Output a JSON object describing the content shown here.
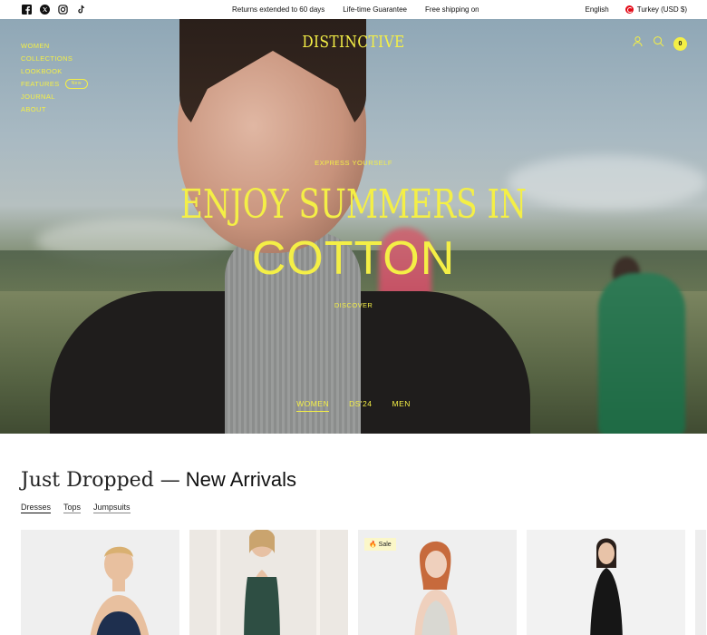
{
  "topbar": {
    "socials": [
      "facebook-icon",
      "x-icon",
      "instagram-icon",
      "tiktok-icon"
    ],
    "announcements": [
      "Returns extended to 60 days",
      "Life-time Guarantee",
      "Free shipping on"
    ],
    "language": "English",
    "currency": "Turkey (USD $)"
  },
  "header": {
    "logo": "DISTINCTIVE",
    "nav": [
      "WOMEN",
      "COLLECTIONS",
      "LOOKBOOK",
      "FEATURES",
      "JOURNAL",
      "ABOUT"
    ],
    "features_badge": "New",
    "cart_count": "0"
  },
  "hero": {
    "eyebrow": "EXPRESS YOURSELF",
    "headline_1": "ENJOY SUMMERS IN",
    "headline_2": "COTTON",
    "cta": "DISCOVER",
    "tabs": [
      "WOMEN",
      "DS'24",
      "MEN"
    ],
    "active_tab": "WOMEN"
  },
  "section": {
    "title_serif": "Just Dropped —",
    "title_sans": "New Arrivals",
    "tabs": [
      "Dresses",
      "Tops",
      "Jumpsuits"
    ],
    "sale_badge": "Sale"
  },
  "colors": {
    "accent": "#f4ef46",
    "text": "#111111"
  }
}
